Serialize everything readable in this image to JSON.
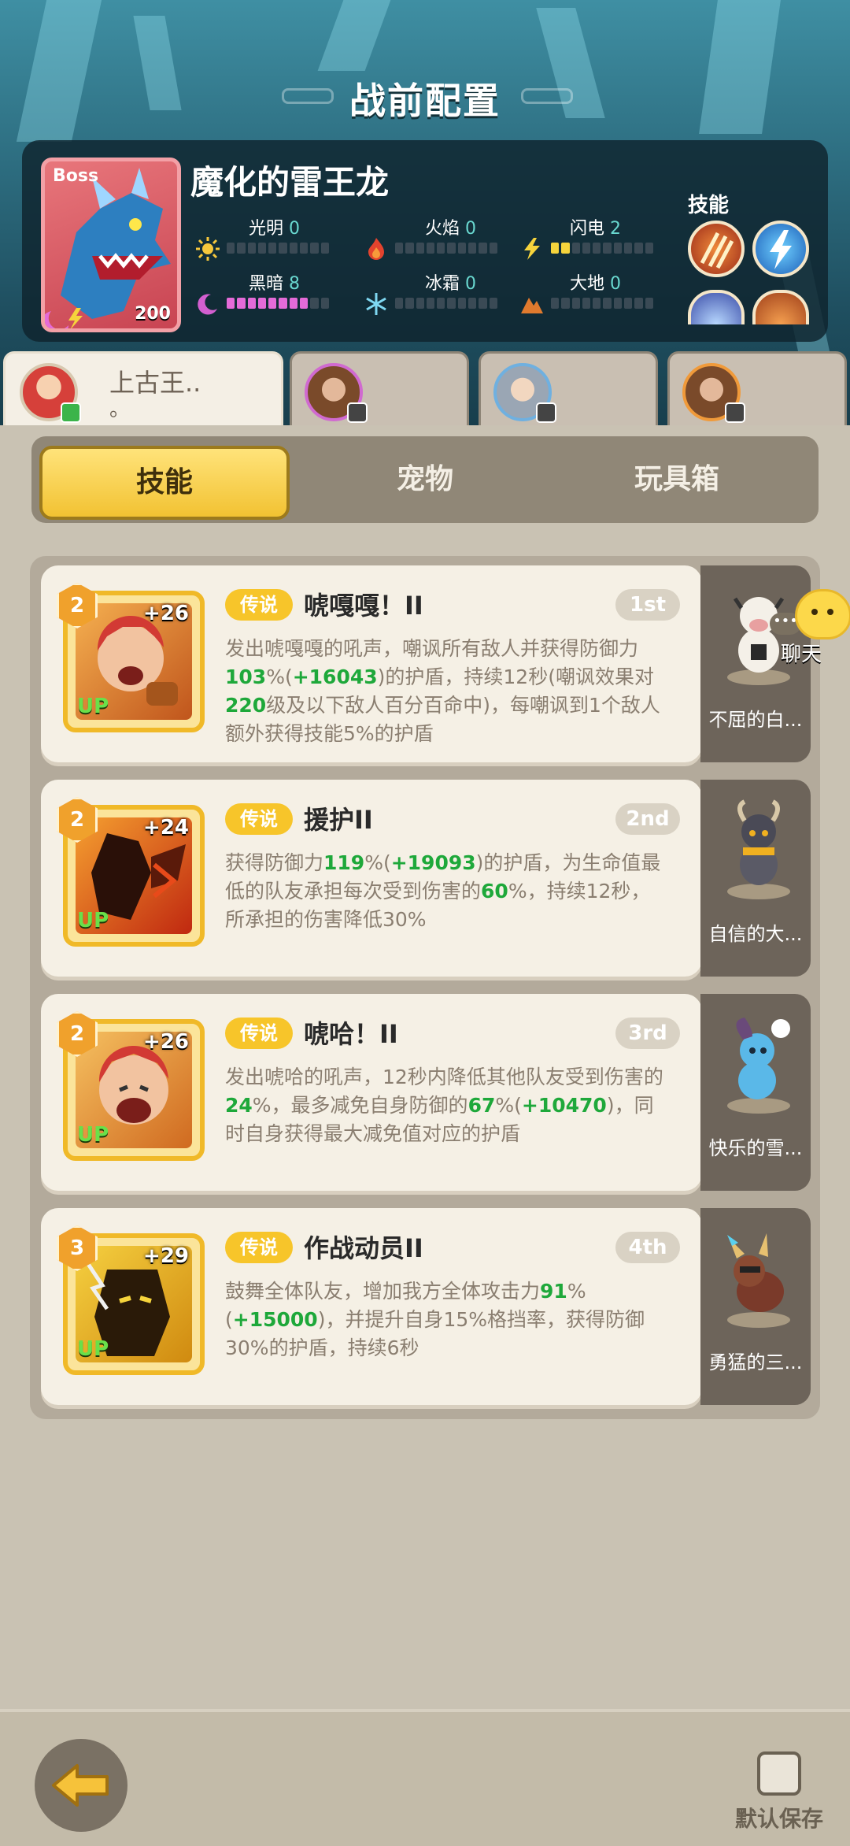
{
  "header": {
    "title": "战前配置"
  },
  "boss": {
    "tag": "Boss",
    "name": "魔化的雷王龙",
    "level": "200",
    "skills_label": "技能",
    "stats": [
      {
        "name": "光明",
        "value": "0",
        "filled": 0,
        "color": "#f6d43c"
      },
      {
        "name": "火焰",
        "value": "0",
        "filled": 0,
        "color": "#f6d43c"
      },
      {
        "name": "闪电",
        "value": "2",
        "filled": 2,
        "color": "#f6d43c"
      },
      {
        "name": "黑暗",
        "value": "8",
        "filled": 8,
        "color": "#e46bd8"
      },
      {
        "name": "冰霜",
        "value": "0",
        "filled": 0,
        "color": "#f6d43c"
      },
      {
        "name": "大地",
        "value": "0",
        "filled": 0,
        "color": "#f6d43c"
      }
    ]
  },
  "party_tabs": [
    {
      "name": "上古王..",
      "sub": "。",
      "active": true
    },
    {
      "name": "",
      "active": false
    },
    {
      "name": "",
      "active": false
    },
    {
      "name": "",
      "active": false
    }
  ],
  "segment": {
    "items": [
      "技能",
      "宠物",
      "玩具箱"
    ],
    "active_index": 0
  },
  "skills": [
    {
      "level": "2",
      "plus": "+26",
      "up": "UP",
      "rarity": "传说",
      "title": "唬嘎嘎！II",
      "rank": "1st",
      "desc": [
        {
          "t": "发出唬嘎嘎的吼声，嘲讽所有敌人并获得防御力"
        },
        {
          "t": "103",
          "g": true
        },
        {
          "t": "%("
        },
        {
          "t": "+16043",
          "g": true
        },
        {
          "t": ")的护盾，持续12秒(嘲讽效果对"
        },
        {
          "t": "220",
          "g": true
        },
        {
          "t": "级及以下敌人百分百命中)，每嘲讽到1个敌人额外获得技能5%的护盾"
        }
      ],
      "pet": "不屈的白..."
    },
    {
      "level": "2",
      "plus": "+24",
      "up": "UP",
      "rarity": "传说",
      "title": "援护II",
      "rank": "2nd",
      "desc": [
        {
          "t": "获得防御力"
        },
        {
          "t": "119",
          "g": true
        },
        {
          "t": "%("
        },
        {
          "t": "+19093",
          "g": true
        },
        {
          "t": ")的护盾，为生命值最低的队友承担每次受到伤害的"
        },
        {
          "t": "60",
          "g": true
        },
        {
          "t": "%，持续12秒，所承担的伤害降低30%"
        }
      ],
      "pet": "自信的大..."
    },
    {
      "level": "2",
      "plus": "+26",
      "up": "UP",
      "rarity": "传说",
      "title": "唬哈！II",
      "rank": "3rd",
      "desc": [
        {
          "t": "发出唬哈的吼声，12秒内降低其他队友受到伤害的"
        },
        {
          "t": "24",
          "g": true
        },
        {
          "t": "%，最多减免自身防御的"
        },
        {
          "t": "67",
          "g": true
        },
        {
          "t": "%("
        },
        {
          "t": "+10470",
          "g": true
        },
        {
          "t": ")，同时自身获得最大减免值对应的护盾"
        }
      ],
      "pet": "快乐的雪..."
    },
    {
      "level": "3",
      "plus": "+29",
      "up": "UP",
      "rarity": "传说",
      "title": "作战动员II",
      "rank": "4th",
      "desc": [
        {
          "t": "鼓舞全体队友，增加我方全体攻击力"
        },
        {
          "t": "91",
          "g": true
        },
        {
          "t": "%("
        },
        {
          "t": "+15000",
          "g": true
        },
        {
          "t": ")，并提升自身15%格挡率，获得防御30%的护盾，持续6秒"
        }
      ],
      "pet": "勇猛的三..."
    }
  ],
  "chat": {
    "label": "聊天",
    "dots": "•••"
  },
  "footer": {
    "default_save_label": "默认保存",
    "default_save_checked": false
  }
}
